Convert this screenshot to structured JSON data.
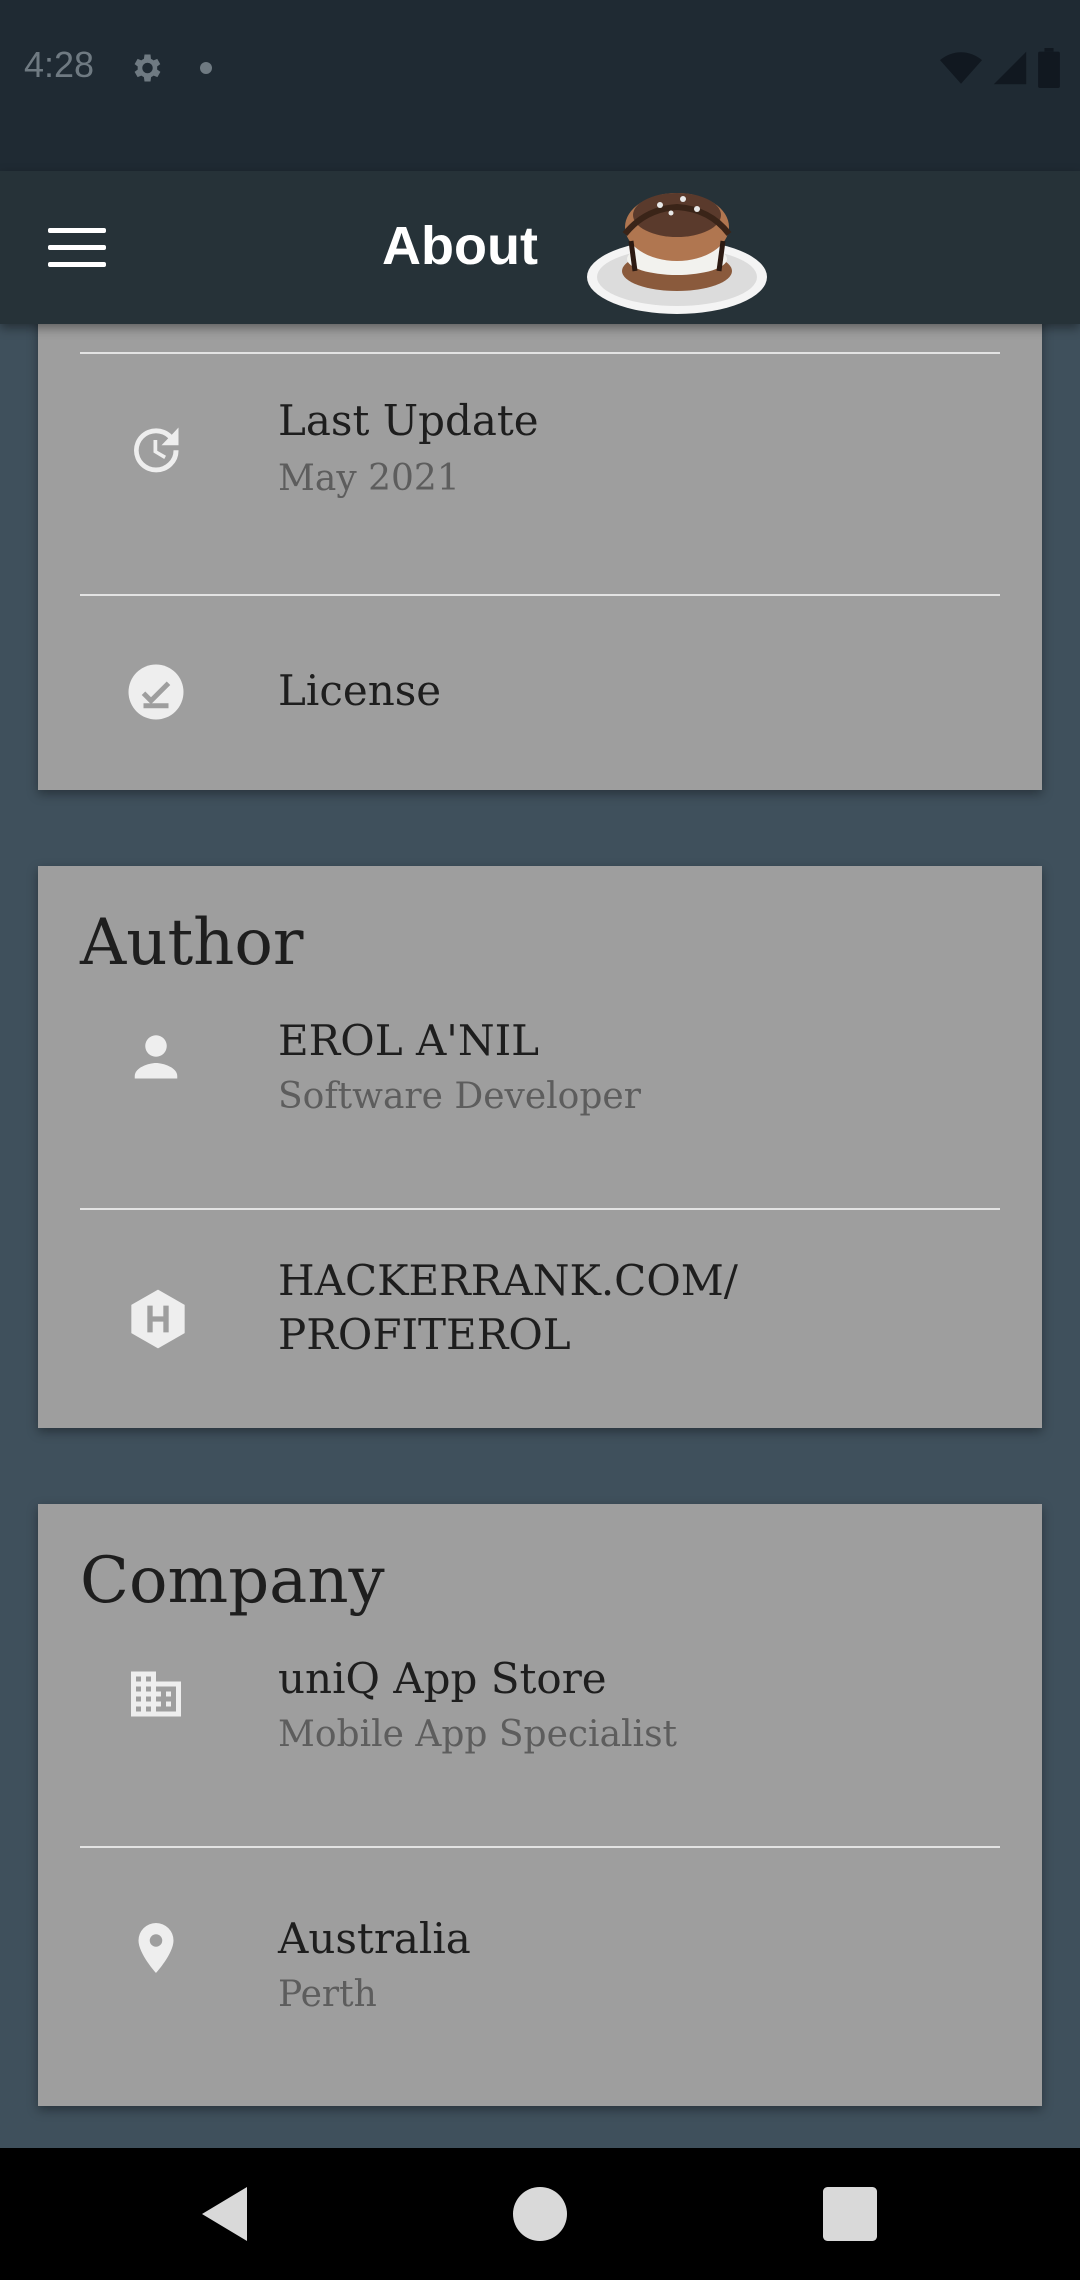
{
  "status_bar": {
    "time": "4:28"
  },
  "app_bar": {
    "title": "About"
  },
  "app_info": {
    "rows": [
      {
        "title": "Last Update",
        "subtitle": "May 2021",
        "icon": "update-icon"
      },
      {
        "title": "License",
        "icon": "license-check-icon"
      }
    ]
  },
  "author": {
    "heading": "Author",
    "rows": [
      {
        "title": "EROL A'NIL",
        "subtitle": "Software Developer",
        "icon": "person-icon"
      },
      {
        "title_line1": "HACKERRANK.COM/",
        "title_line2": "PROFITEROL",
        "icon": "hackerrank-icon"
      }
    ]
  },
  "company": {
    "heading": "Company",
    "rows": [
      {
        "title": "uniQ App Store",
        "subtitle": "Mobile App Specialist",
        "icon": "building-icon"
      },
      {
        "title": "Australia",
        "subtitle": "Perth",
        "icon": "location-pin-icon"
      }
    ]
  },
  "colors": {
    "background": "#3f505c",
    "app_bar": "#263238",
    "card": "#9e9e9e",
    "icon": "#eeeeee"
  }
}
